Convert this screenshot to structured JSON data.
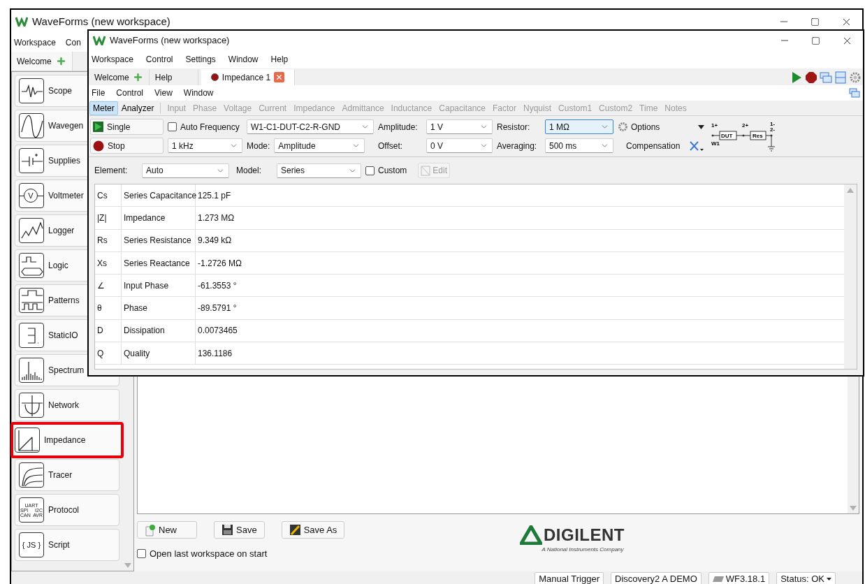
{
  "outer_window": {
    "title": "WaveForms (new workspace)",
    "menu": [
      "Workspace",
      "Con"
    ],
    "tabs": [
      {
        "label": "Welcome",
        "selected": true
      }
    ],
    "instruments": [
      {
        "label": "Scope",
        "kind": "scope",
        "highlighted": false
      },
      {
        "label": "Wavegen",
        "kind": "wavegen",
        "highlighted": false
      },
      {
        "label": "Supplies",
        "kind": "supplies",
        "highlighted": false
      },
      {
        "label": "Voltmeter",
        "kind": "voltmeter",
        "highlighted": false,
        "icon_text": [
          "V"
        ]
      },
      {
        "label": "Logger",
        "kind": "logger",
        "highlighted": false
      },
      {
        "label": "Logic",
        "kind": "logic",
        "highlighted": false
      },
      {
        "label": "Patterns",
        "kind": "patterns",
        "highlighted": false
      },
      {
        "label": "StaticIO",
        "kind": "staticio",
        "highlighted": false
      },
      {
        "label": "Spectrum",
        "kind": "spectrum",
        "highlighted": false
      },
      {
        "label": "Network",
        "kind": "network",
        "highlighted": false
      },
      {
        "label": "Impedance",
        "kind": "impedance",
        "highlighted": true
      },
      {
        "label": "Tracer",
        "kind": "tracer",
        "highlighted": false
      },
      {
        "label": "Protocol",
        "kind": "protocol",
        "highlighted": false,
        "icon_text": [
          "UART",
          "SPI",
          "I2C",
          "CAN",
          "AVR"
        ]
      },
      {
        "label": "Script",
        "kind": "script",
        "highlighted": false,
        "icon_text": [
          "{ JS }"
        ]
      }
    ],
    "buttons": [
      {
        "label": "New",
        "kind": "new"
      },
      {
        "label": "Save",
        "kind": "save"
      },
      {
        "label": "Save As",
        "kind": "saveas"
      }
    ],
    "open_last": {
      "label": "Open last workspace on start",
      "checked": false
    },
    "logo": {
      "name": "DIGILENT",
      "tagline": "A National Instruments Company"
    },
    "status_bar": [
      {
        "label": "Manual Trigger",
        "kind": "plain"
      },
      {
        "label": "Discovery2 A DEMO",
        "kind": "plain"
      },
      {
        "label": "WF3.18.1",
        "kind": "version"
      },
      {
        "label": "Status: OK",
        "kind": "menu"
      }
    ]
  },
  "inner_window": {
    "title": "WaveForms (new workspace)",
    "menu": [
      "Workspace",
      "Control",
      "Settings",
      "Window",
      "Help"
    ],
    "tabs": [
      {
        "label": "Welcome",
        "kind": "add",
        "selected": false
      },
      {
        "label": "Help",
        "kind": "plain",
        "selected": false
      },
      {
        "label": "Impedance 1",
        "kind": "instrument",
        "selected": true
      }
    ],
    "submenu": [
      "File",
      "Control",
      "View",
      "Window"
    ],
    "views": [
      {
        "label": "Meter",
        "selected": true,
        "disabled": false,
        "separator_before": false
      },
      {
        "label": "Analyzer",
        "selected": false,
        "disabled": false,
        "separator_before": false
      },
      {
        "label": "Input",
        "selected": false,
        "disabled": true,
        "separator_before": true
      },
      {
        "label": "Phase",
        "selected": false,
        "disabled": true,
        "separator_before": false
      },
      {
        "label": "Voltage",
        "selected": false,
        "disabled": true,
        "separator_before": false
      },
      {
        "label": "Current",
        "selected": false,
        "disabled": true,
        "separator_before": false
      },
      {
        "label": "Impedance",
        "selected": false,
        "disabled": true,
        "separator_before": false
      },
      {
        "label": "Admittance",
        "selected": false,
        "disabled": true,
        "separator_before": false
      },
      {
        "label": "Inductance",
        "selected": false,
        "disabled": true,
        "separator_before": false
      },
      {
        "label": "Capacitance",
        "selected": false,
        "disabled": true,
        "separator_before": false
      },
      {
        "label": "Factor",
        "selected": false,
        "disabled": true,
        "separator_before": false
      },
      {
        "label": "Nyquist",
        "selected": false,
        "disabled": true,
        "separator_before": false
      },
      {
        "label": "Custom1",
        "selected": false,
        "disabled": true,
        "separator_before": false
      },
      {
        "label": "Custom2",
        "selected": false,
        "disabled": true,
        "separator_before": false
      },
      {
        "label": "Time",
        "selected": false,
        "disabled": true,
        "separator_before": false
      },
      {
        "label": "Notes",
        "selected": false,
        "disabled": true,
        "separator_before": false
      }
    ],
    "controls": {
      "single": "Single",
      "stop": "Stop",
      "auto_frequency": {
        "label": "Auto Frequency",
        "checked": false
      },
      "frequency": {
        "value": "1 kHz",
        "focused": false
      },
      "connection": {
        "value": "W1-C1-DUT-C2-R-GND",
        "focused": false
      },
      "mode_label": "Mode:",
      "mode": {
        "value": "Amplitude",
        "focused": false
      },
      "amplitude_label": "Amplitude:",
      "amplitude": {
        "value": "1 V",
        "focused": false
      },
      "offset_label": "Offset:",
      "offset": {
        "value": "0 V",
        "focused": false
      },
      "resistor_label": "Resistor:",
      "resistor": {
        "value": "1 MΩ",
        "focused": true
      },
      "averaging_label": "Averaging:",
      "averaging": {
        "value": "500 ms",
        "focused": false
      },
      "options": "Options",
      "compensation": "Compensation"
    },
    "circuit": {
      "pos1": "1+",
      "pos2": "2+",
      "neg1": "1-",
      "neg2": "2-",
      "dut": "DUT",
      "res": "Res",
      "source": "W1"
    },
    "element_label": "Element:",
    "element": {
      "value": "Auto",
      "focused": false
    },
    "model_label": "Model:",
    "model": {
      "value": "Series",
      "focused": false
    },
    "custom": {
      "label": "Custom",
      "checked": false
    },
    "edit": {
      "label": "Edit",
      "disabled": true
    },
    "table": {
      "rows": [
        {
          "symbol": "Cs",
          "name": "Series Capacitance",
          "value": "125.1 pF"
        },
        {
          "symbol": "|Z|",
          "name": "Impedance",
          "value": "1.273 MΩ"
        },
        {
          "symbol": "Rs",
          "name": "Series Resistance",
          "value": "9.349 kΩ"
        },
        {
          "symbol": "Xs",
          "name": "Series Reactance",
          "value": "-1.2726 MΩ"
        },
        {
          "symbol": "∠",
          "name": "Input Phase",
          "value": "-61.3553 °"
        },
        {
          "symbol": "θ",
          "name": "Phase",
          "value": "-89.5791 °"
        },
        {
          "symbol": "D",
          "name": "Dissipation",
          "value": "0.0073465"
        },
        {
          "symbol": "Q",
          "name": "Quality",
          "value": "136.1186"
        }
      ]
    }
  }
}
